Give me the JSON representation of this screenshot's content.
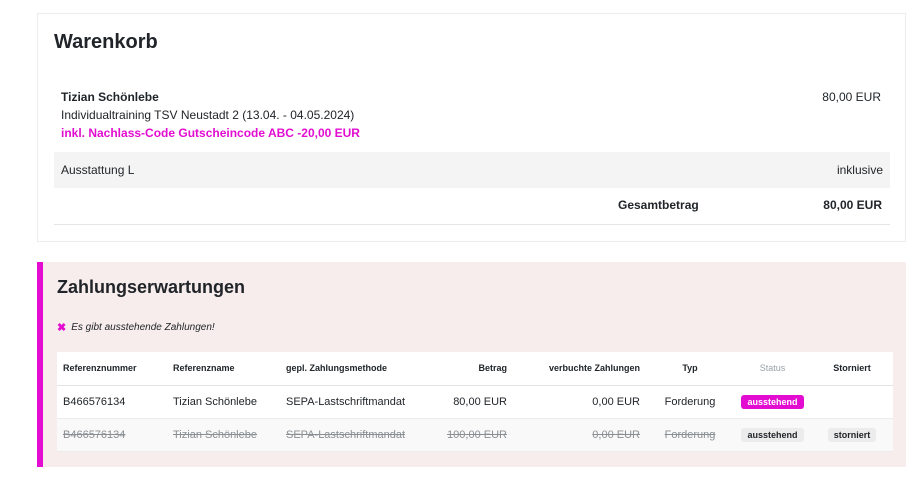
{
  "cart": {
    "title": "Warenkorb",
    "item": {
      "name": "Tizian Schönlebe",
      "description": "Individualtraining TSV Neustadt 2 (13.04. - 04.05.2024)",
      "discount": "inkl. Nachlass-Code Gutscheincode ABC -20,00 EUR",
      "price": "80,00 EUR"
    },
    "extra": {
      "label": "Ausstattung L",
      "value": "inklusive"
    },
    "total": {
      "label": "Gesamtbetrag",
      "value": "80,00 EUR"
    }
  },
  "payments": {
    "title": "Zahlungserwartungen",
    "alert": "Es gibt ausstehende Zahlungen!",
    "columns": {
      "ref_number": "Referenznummer",
      "ref_name": "Referenzname",
      "method": "gepl. Zahlungsmethode",
      "amount": "Betrag",
      "booked": "verbuchte Zahlungen",
      "type": "Typ",
      "status": "Status",
      "cancelled": "Storniert"
    },
    "rows": [
      {
        "ref_number": "B466576134",
        "ref_name": "Tizian Schönlebe",
        "method": "SEPA-Lastschriftmandat",
        "amount": "80,00 EUR",
        "booked": "0,00 EUR",
        "type": "Forderung",
        "status": "ausstehend",
        "cancelled": ""
      },
      {
        "ref_number": "B466576134",
        "ref_name": "Tizian Schönlebe",
        "method": "SEPA-Lastschriftmandat",
        "amount": "100,00 EUR",
        "booked": "0,00 EUR",
        "type": "Forderung",
        "status": "ausstehend",
        "cancelled": "storniert"
      }
    ]
  },
  "colors": {
    "accent": "#e20dd1",
    "panel_bg": "#f7eded"
  }
}
